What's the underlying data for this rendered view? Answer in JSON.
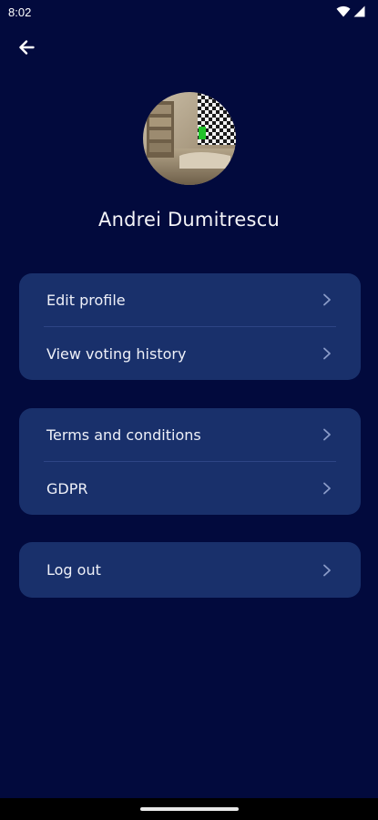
{
  "status_bar": {
    "time": "8:02",
    "icons": [
      "wifi-icon",
      "cellular-signal-icon"
    ]
  },
  "header": {
    "back_icon": "arrow-left-icon"
  },
  "profile": {
    "name": "Andrei Dumitrescu"
  },
  "menu_groups": [
    {
      "items": [
        {
          "label": "Edit profile",
          "icon": "chevron-right-icon"
        },
        {
          "label": "View voting history",
          "icon": "chevron-right-icon"
        }
      ]
    },
    {
      "items": [
        {
          "label": "Terms and conditions",
          "icon": "chevron-right-icon"
        },
        {
          "label": "GDPR",
          "icon": "chevron-right-icon"
        }
      ]
    },
    {
      "items": [
        {
          "label": "Log out",
          "icon": "chevron-right-icon"
        }
      ]
    }
  ],
  "colors": {
    "background": "#020a3d",
    "card": "#19306b",
    "divider": "#2e4585",
    "chevron": "#8a9bc8",
    "text": "#eef0f8"
  }
}
